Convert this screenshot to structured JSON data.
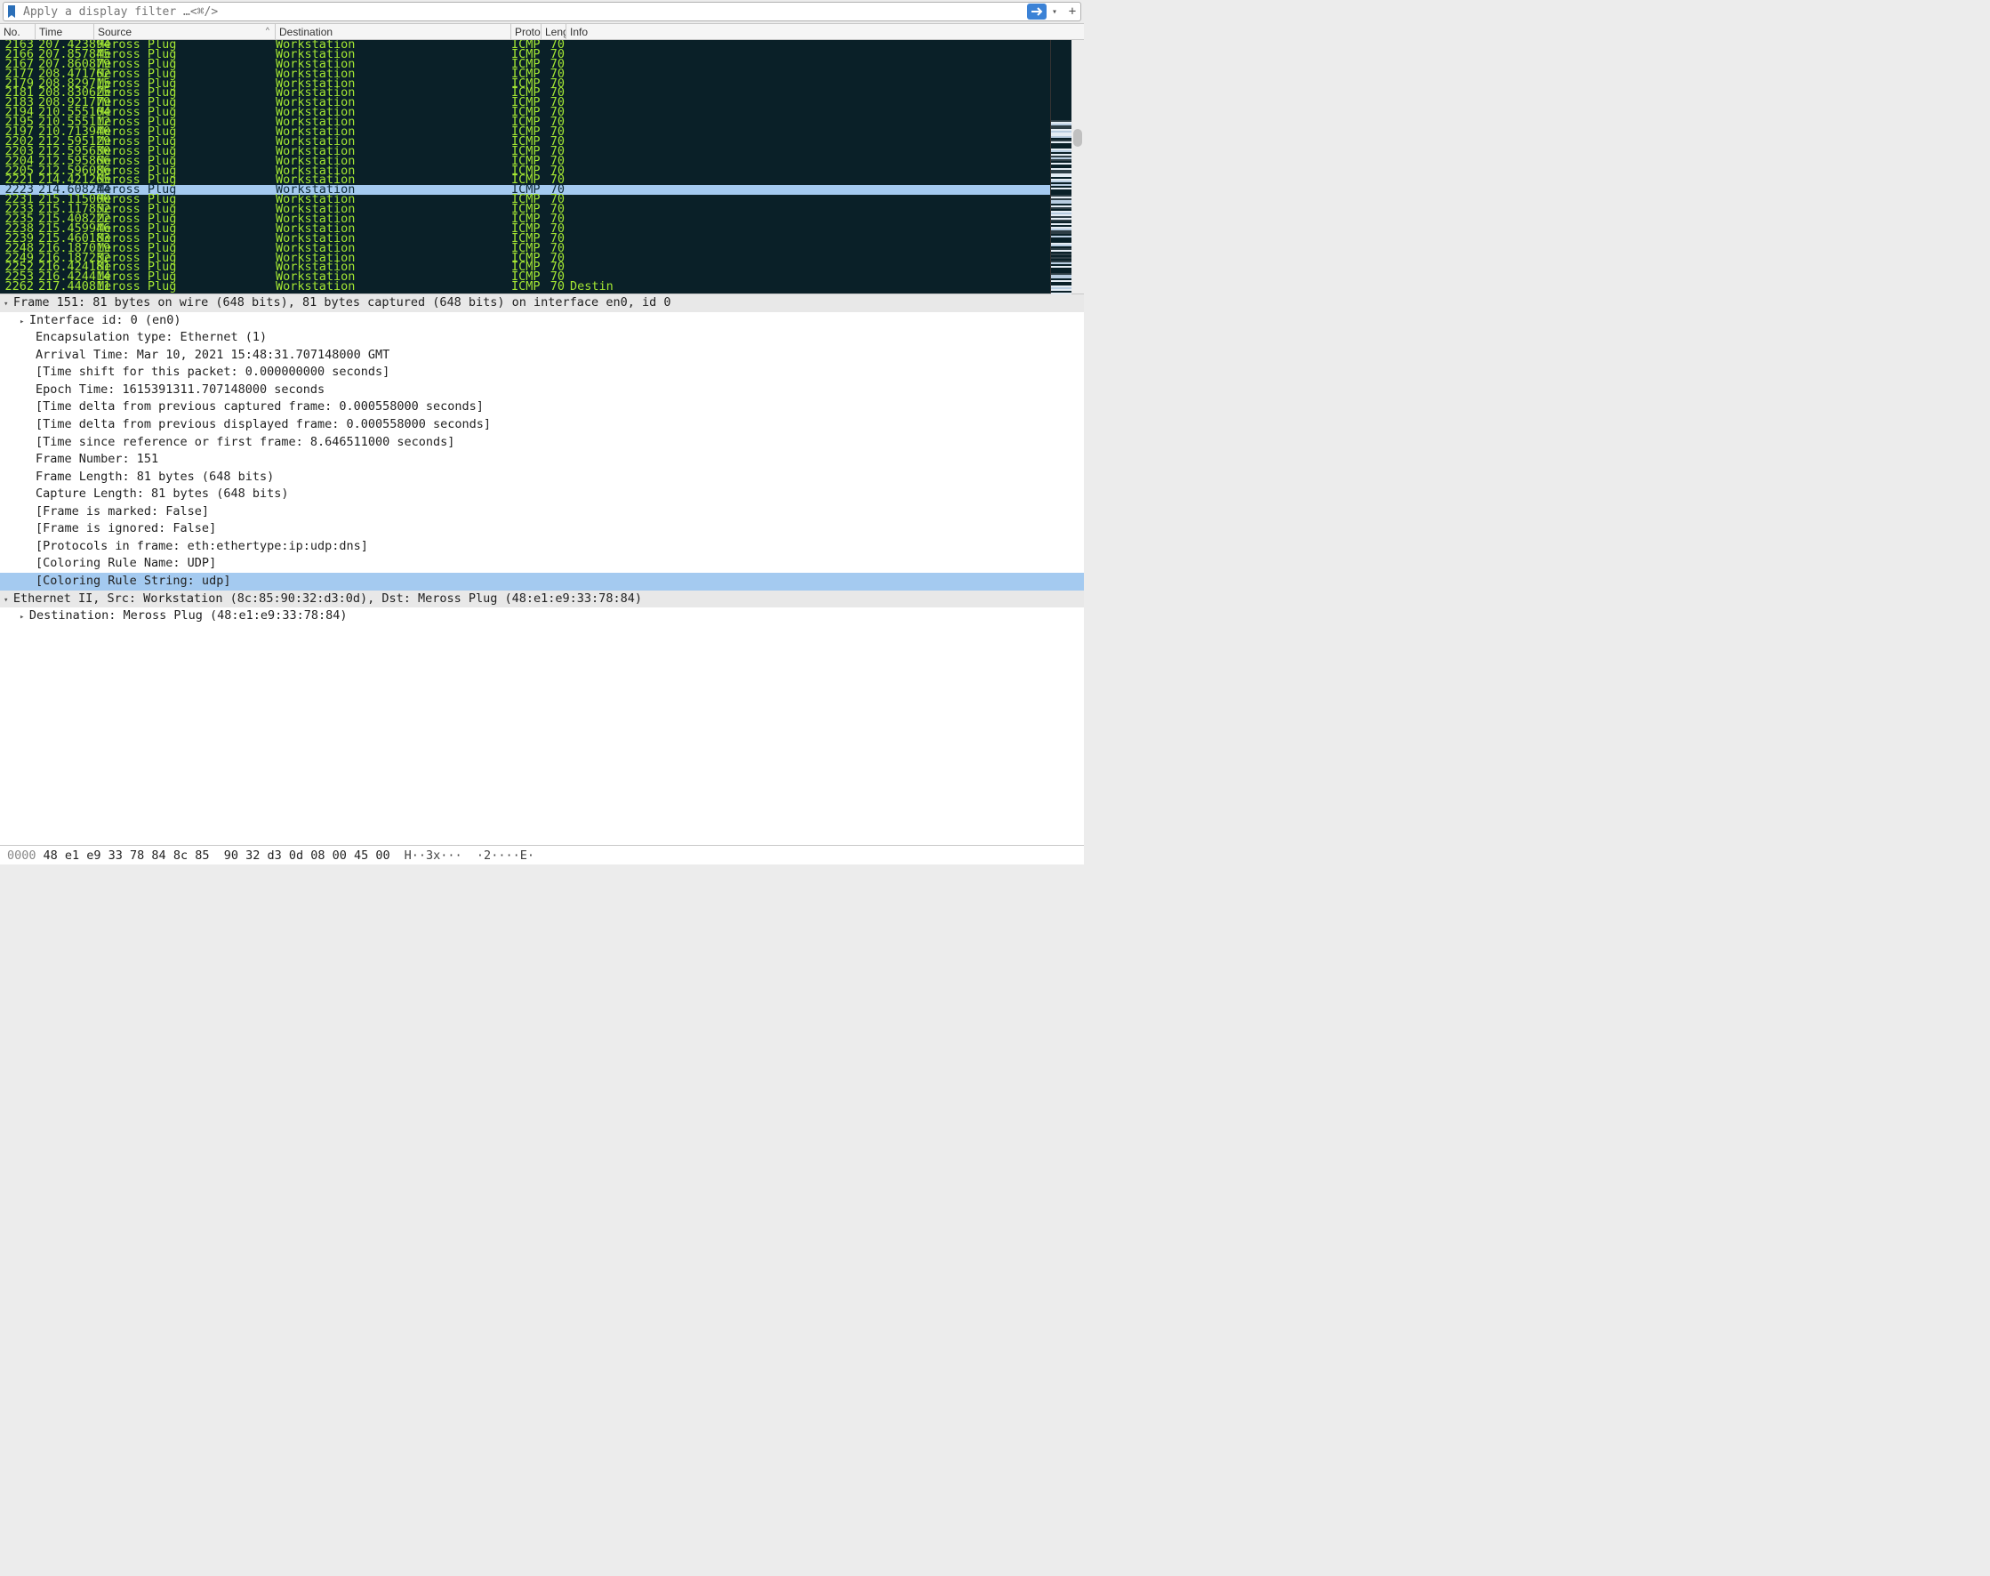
{
  "filter": {
    "placeholder": "Apply a display filter …<⌘/>"
  },
  "columns": {
    "no": "No.",
    "time": "Time",
    "source": "Source",
    "destination": "Destination",
    "protocol": "Protocol",
    "length": "Length",
    "info": "Info"
  },
  "packets": [
    {
      "no": "2163",
      "time": "207.423894",
      "src": "Meross Plug",
      "dst": "Workstation",
      "proto": "ICMP",
      "len": "70",
      "info": ""
    },
    {
      "no": "2166",
      "time": "207.857845",
      "src": "Meross Plug",
      "dst": "Workstation",
      "proto": "ICMP",
      "len": "70",
      "info": ""
    },
    {
      "no": "2167",
      "time": "207.860879",
      "src": "Meross Plug",
      "dst": "Workstation",
      "proto": "ICMP",
      "len": "70",
      "info": ""
    },
    {
      "no": "2177",
      "time": "208.471762",
      "src": "Meross Plug",
      "dst": "Workstation",
      "proto": "ICMP",
      "len": "70",
      "info": ""
    },
    {
      "no": "2179",
      "time": "208.829715",
      "src": "Meross Plug",
      "dst": "Workstation",
      "proto": "ICMP",
      "len": "70",
      "info": ""
    },
    {
      "no": "2181",
      "time": "208.830625",
      "src": "Meross Plug",
      "dst": "Workstation",
      "proto": "ICMP",
      "len": "70",
      "info": ""
    },
    {
      "no": "2183",
      "time": "208.921779",
      "src": "Meross Plug",
      "dst": "Workstation",
      "proto": "ICMP",
      "len": "70",
      "info": ""
    },
    {
      "no": "2194",
      "time": "210.555104",
      "src": "Meross Plug",
      "dst": "Workstation",
      "proto": "ICMP",
      "len": "70",
      "info": ""
    },
    {
      "no": "2195",
      "time": "210.555112",
      "src": "Meross Plug",
      "dst": "Workstation",
      "proto": "ICMP",
      "len": "70",
      "info": ""
    },
    {
      "no": "2197",
      "time": "210.713940",
      "src": "Meross Plug",
      "dst": "Workstation",
      "proto": "ICMP",
      "len": "70",
      "info": ""
    },
    {
      "no": "2202",
      "time": "212.595129",
      "src": "Meross Plug",
      "dst": "Workstation",
      "proto": "ICMP",
      "len": "70",
      "info": ""
    },
    {
      "no": "2203",
      "time": "212.595630",
      "src": "Meross Plug",
      "dst": "Workstation",
      "proto": "ICMP",
      "len": "70",
      "info": ""
    },
    {
      "no": "2204",
      "time": "212.595866",
      "src": "Meross Plug",
      "dst": "Workstation",
      "proto": "ICMP",
      "len": "70",
      "info": ""
    },
    {
      "no": "2205",
      "time": "212.596086",
      "src": "Meross Plug",
      "dst": "Workstation",
      "proto": "ICMP",
      "len": "70",
      "info": ""
    },
    {
      "no": "2221",
      "time": "214.421265",
      "src": "Meross Plug",
      "dst": "Workstation",
      "proto": "ICMP",
      "len": "70",
      "info": ""
    },
    {
      "no": "2223",
      "time": "214.608244",
      "src": "Meross Plug",
      "dst": "Workstation",
      "proto": "ICMP",
      "len": "70",
      "info": "",
      "selected": true
    },
    {
      "no": "2231",
      "time": "215.115000",
      "src": "Meross Plug",
      "dst": "Workstation",
      "proto": "ICMP",
      "len": "70",
      "info": ""
    },
    {
      "no": "2233",
      "time": "215.117852",
      "src": "Meross Plug",
      "dst": "Workstation",
      "proto": "ICMP",
      "len": "70",
      "info": ""
    },
    {
      "no": "2235",
      "time": "215.408222",
      "src": "Meross Plug",
      "dst": "Workstation",
      "proto": "ICMP",
      "len": "70",
      "info": ""
    },
    {
      "no": "2238",
      "time": "215.459946",
      "src": "Meross Plug",
      "dst": "Workstation",
      "proto": "ICMP",
      "len": "70",
      "info": ""
    },
    {
      "no": "2239",
      "time": "215.460183",
      "src": "Meross Plug",
      "dst": "Workstation",
      "proto": "ICMP",
      "len": "70",
      "info": ""
    },
    {
      "no": "2248",
      "time": "216.187019",
      "src": "Meross Plug",
      "dst": "Workstation",
      "proto": "ICMP",
      "len": "70",
      "info": ""
    },
    {
      "no": "2249",
      "time": "216.187232",
      "src": "Meross Plug",
      "dst": "Workstation",
      "proto": "ICMP",
      "len": "70",
      "info": ""
    },
    {
      "no": "2252",
      "time": "216.424181",
      "src": "Meross Plug",
      "dst": "Workstation",
      "proto": "ICMP",
      "len": "70",
      "info": ""
    },
    {
      "no": "2253",
      "time": "216.424414",
      "src": "Meross Plug",
      "dst": "Workstation",
      "proto": "ICMP",
      "len": "70",
      "info": ""
    },
    {
      "no": "2262",
      "time": "217.440811",
      "src": "Meross Plug",
      "dst": "Workstation",
      "proto": "ICMP",
      "len": "70",
      "info": "Destin"
    }
  ],
  "details": {
    "frame_header": "Frame 151: 81 bytes on wire (648 bits), 81 bytes captured (648 bits) on interface en0, id 0",
    "interface_id": "Interface id: 0 (en0)",
    "encapsulation": "Encapsulation type: Ethernet (1)",
    "arrival_time": "Arrival Time: Mar 10, 2021 15:48:31.707148000 GMT",
    "time_shift": "[Time shift for this packet: 0.000000000 seconds]",
    "epoch_time": "Epoch Time: 1615391311.707148000 seconds",
    "delta_captured": "[Time delta from previous captured frame: 0.000558000 seconds]",
    "delta_displayed": "[Time delta from previous displayed frame: 0.000558000 seconds]",
    "since_ref": "[Time since reference or first frame: 8.646511000 seconds]",
    "frame_number": "Frame Number: 151",
    "frame_length": "Frame Length: 81 bytes (648 bits)",
    "capture_length": "Capture Length: 81 bytes (648 bits)",
    "frame_marked": "[Frame is marked: False]",
    "frame_ignored": "[Frame is ignored: False]",
    "protocols": "[Protocols in frame: eth:ethertype:ip:udp:dns]",
    "coloring_name": "[Coloring Rule Name: UDP]",
    "coloring_string": "[Coloring Rule String: udp]",
    "ethernet_header": "Ethernet II, Src: Workstation (8c:85:90:32:d3:0d), Dst: Meross Plug (48:e1:e9:33:78:84)",
    "eth_dst": "Destination: Meross Plug (48:e1:e9:33:78:84)"
  },
  "hex": {
    "offset": "0000",
    "bytes": "48 e1 e9 33 78 84 8c 85  90 32 d3 0d 08 00 45 00",
    "ascii": "H··3x···  ·2····E·"
  }
}
